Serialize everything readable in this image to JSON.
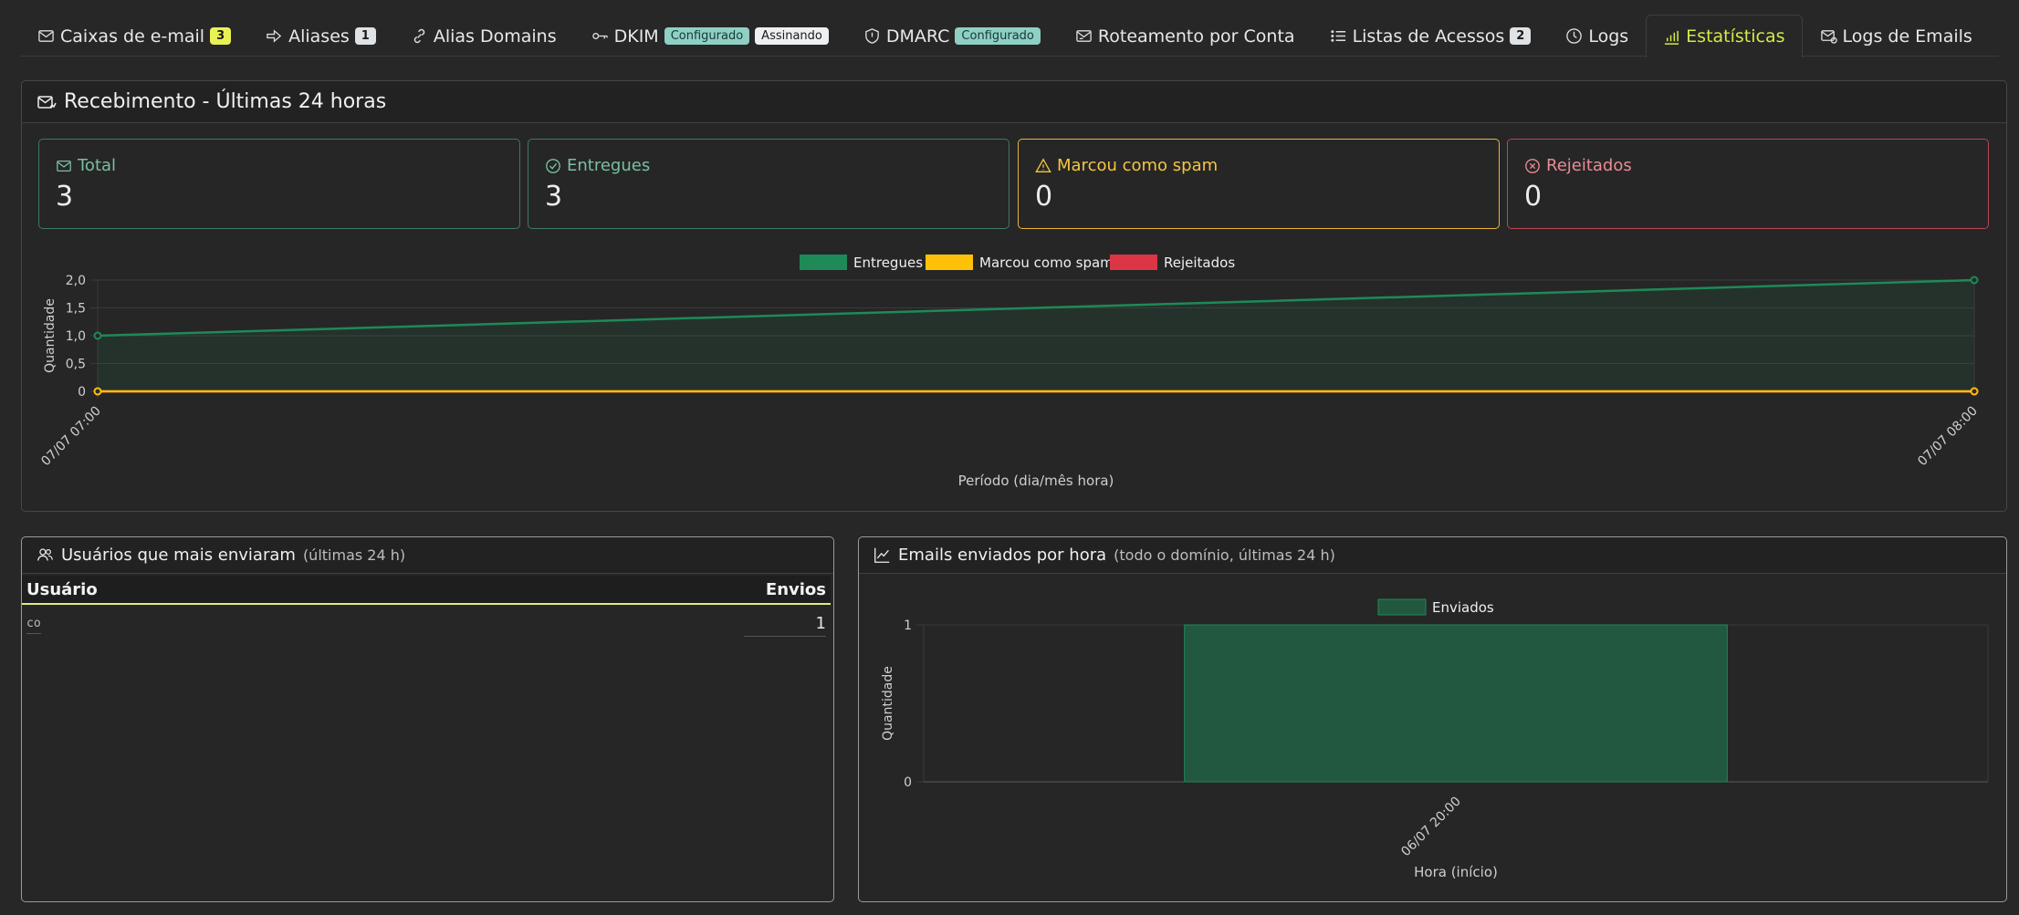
{
  "tabs": [
    {
      "label": "Caixas de e-mail",
      "icon": "mailbox-icon",
      "badge": "3"
    },
    {
      "label": "Aliases",
      "icon": "arrow-right-icon",
      "badge": "1"
    },
    {
      "label": "Alias Domains",
      "icon": "link-icon"
    },
    {
      "label": "DKIM",
      "icon": "key-icon",
      "tags": [
        "Configurado",
        "Assinando"
      ]
    },
    {
      "label": "DMARC",
      "icon": "shield-icon",
      "tags": [
        "Configurado"
      ]
    },
    {
      "label": "Roteamento por Conta",
      "icon": "mail-route-icon"
    },
    {
      "label": "Listas de Acessos",
      "icon": "list-icon",
      "badge": "2"
    },
    {
      "label": "Logs",
      "icon": "clock-icon"
    },
    {
      "label": "Estatísticas",
      "icon": "bar-chart-icon",
      "active": true
    },
    {
      "label": "Logs de Emails",
      "icon": "mail-log-icon"
    }
  ],
  "receive": {
    "title": "Recebimento - Últimas 24 horas",
    "stats": [
      {
        "label": "Total",
        "value": "3",
        "color": "#5fa88a"
      },
      {
        "label": "Entregues",
        "value": "3",
        "color": "#5fa88a"
      },
      {
        "label": "Marcou como spam",
        "value": "0",
        "color": "#f5c542"
      },
      {
        "label": "Rejeitados",
        "value": "0",
        "color": "#e6747f"
      }
    ]
  },
  "top_users": {
    "title": "Usuários que mais enviaram",
    "subtitle": "(últimas 24 h)",
    "col_user": "Usuário",
    "col_sends": "Envios",
    "rows": [
      {
        "user": "co",
        "sends": "1"
      }
    ]
  },
  "hourly": {
    "title": "Emails enviados por hora",
    "subtitle": "(todo o domínio, últimas 24 h)"
  },
  "chart_data": [
    {
      "type": "line",
      "x": [
        "07/07 07:00",
        "07/07 08:00"
      ],
      "series": [
        {
          "name": "Entregues",
          "values": [
            1,
            2
          ],
          "color": "#1e8a57"
        },
        {
          "name": "Marcou como spam",
          "values": [
            0,
            0
          ],
          "color": "#ffc107"
        },
        {
          "name": "Rejeitados",
          "values": [
            0,
            0
          ],
          "color": "#dc3545"
        }
      ],
      "xlabel": "Período (dia/mês hora)",
      "ylabel": "Quantidade",
      "ylim": [
        0,
        2
      ],
      "yticks": [
        "0",
        "0,5",
        "1,0",
        "1,5",
        "2,0"
      ],
      "legend": "top"
    },
    {
      "type": "bar",
      "categories": [
        "06/07 20:00"
      ],
      "series": [
        {
          "name": "Enviados",
          "values": [
            1
          ],
          "color": "#1e8a57"
        }
      ],
      "xlabel": "Hora (início)",
      "ylabel": "Quantidade",
      "ylim": [
        0,
        1
      ],
      "yticks": [
        "0",
        "1"
      ],
      "legend": "top"
    }
  ]
}
